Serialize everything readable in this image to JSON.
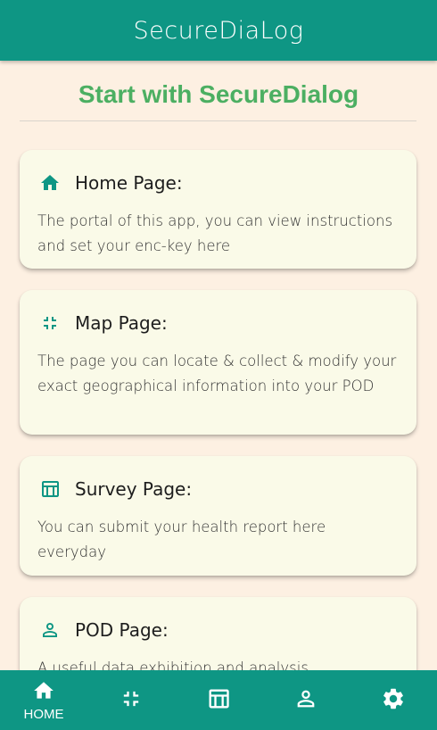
{
  "appbar": {
    "title": "SecureDiaLog"
  },
  "heading": "Start with SecureDialog",
  "cards": [
    {
      "title": "Home Page:",
      "icon": "home-icon",
      "description": "The portal of this app, you can view instructions and set your enc-key here"
    },
    {
      "title": "Map Page:",
      "icon": "compress-arrows-icon",
      "description": "The page you can locate & collect & modify your exact geographical information into your POD"
    },
    {
      "title": "Survey Page:",
      "icon": "table-icon",
      "description": "You can submit your health report here everyday"
    },
    {
      "title": "POD Page:",
      "icon": "person-icon",
      "description": "A useful data exhibition and analysis"
    }
  ],
  "bottom_nav": {
    "items": [
      {
        "label": "HOME",
        "icon": "home-icon",
        "selected": true
      },
      {
        "label": "",
        "icon": "compress-arrows-icon",
        "selected": false
      },
      {
        "label": "",
        "icon": "table-icon",
        "selected": false
      },
      {
        "label": "",
        "icon": "person-icon",
        "selected": false
      },
      {
        "label": "",
        "icon": "gear-icon",
        "selected": false
      }
    ]
  },
  "colors": {
    "primary": "#0e9684",
    "heading": "#4caf62",
    "background": "#fdf0e2",
    "card": "#fafae8"
  }
}
